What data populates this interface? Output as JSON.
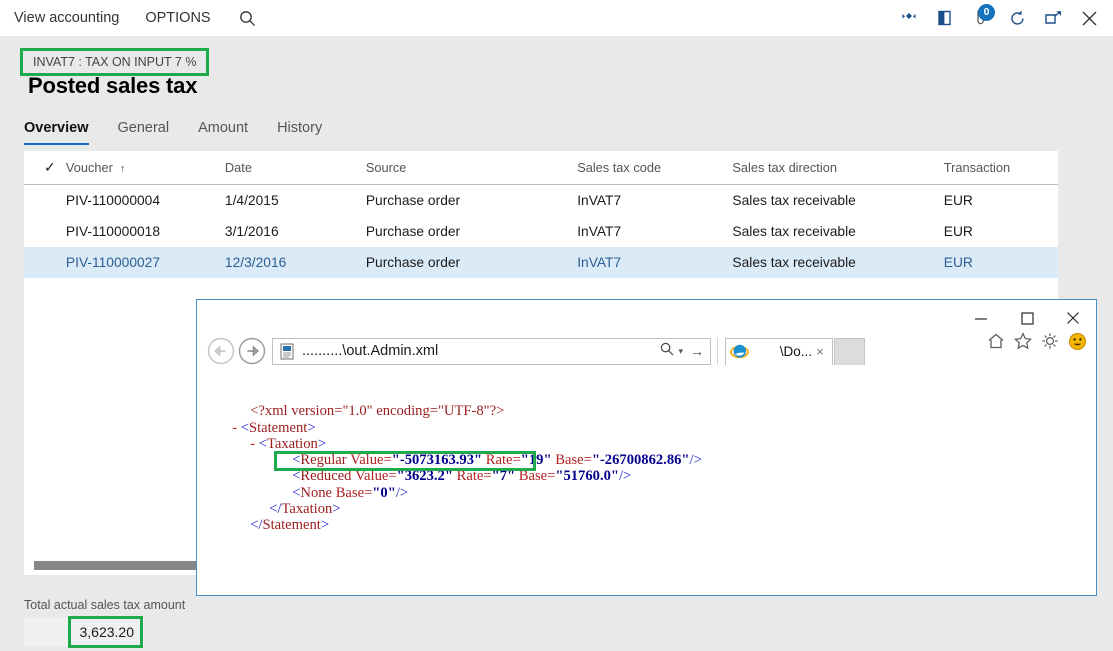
{
  "topbar": {
    "menu": [
      {
        "label": "View accounting",
        "name": "view-accounting-menu"
      },
      {
        "label": "OPTIONS",
        "name": "options-menu"
      }
    ],
    "search_icon": "search-icon",
    "right_icons": [
      {
        "name": "diamond-nav-icon",
        "glyph": "❖"
      },
      {
        "name": "company-icon",
        "glyph": "◧"
      },
      {
        "name": "notifications-icon",
        "glyph": "⚑",
        "badge": "0"
      },
      {
        "name": "refresh-icon",
        "glyph": "↻"
      },
      {
        "name": "popout-icon",
        "glyph": "↗"
      },
      {
        "name": "close-icon",
        "glyph": "✕"
      }
    ]
  },
  "header": {
    "breadcrumb": "INVAT7 : TAX ON INPUT 7 %",
    "title": "Posted sales tax"
  },
  "tabs": [
    {
      "label": "Overview",
      "active": true
    },
    {
      "label": "General",
      "active": false
    },
    {
      "label": "Amount",
      "active": false
    },
    {
      "label": "History",
      "active": false
    }
  ],
  "grid": {
    "columns": [
      "Voucher",
      "Date",
      "Source",
      "Sales tax code",
      "Sales tax direction",
      "Transaction"
    ],
    "sort_column": "Voucher",
    "sort_direction": "ascending",
    "check_glyph": "✓",
    "sort_glyph": "↑",
    "rows": [
      {
        "voucher": "PIV-110000004",
        "date": "1/4/2015",
        "source": "Purchase order",
        "code": "InVAT7",
        "direction": "Sales tax receivable",
        "currency": "EUR",
        "selected": false
      },
      {
        "voucher": "PIV-110000018",
        "date": "3/1/2016",
        "source": "Purchase order",
        "code": "InVAT7",
        "direction": "Sales tax receivable",
        "currency": "EUR",
        "selected": false
      },
      {
        "voucher": "PIV-110000027",
        "date": "12/3/2016",
        "source": "Purchase order",
        "code": "InVAT7",
        "direction": "Sales tax receivable",
        "currency": "EUR",
        "selected": true
      }
    ]
  },
  "total": {
    "label": "Total actual sales tax amount",
    "value": "3,623.20"
  },
  "browser": {
    "address": "..........\\out.Admin.xml",
    "tab_label": "\\Do...",
    "tab_close": "×",
    "nav": {
      "back": "←",
      "forward": "→",
      "search_dropdown": "▾",
      "go": "→"
    },
    "window_buttons": {
      "minimize": "─",
      "maximize": "□",
      "close": "✕"
    },
    "tools": [
      {
        "name": "home-icon",
        "glyph": "⌂"
      },
      {
        "name": "favorites-star-icon",
        "glyph": "☆"
      },
      {
        "name": "settings-gear-icon",
        "glyph": "⚙"
      },
      {
        "name": "smiley-feedback-icon",
        "glyph": "☺"
      }
    ]
  },
  "xml": {
    "declaration": "<?xml version=\"1.0\" encoding=\"UTF-8\"?>",
    "lines": [
      {
        "indent": 0,
        "minus": false,
        "text": "<?xml version=\"1.0\" encoding=\"UTF-8\"?>",
        "kind": "pi"
      },
      {
        "indent": 0,
        "minus": true,
        "text": "<Statement>",
        "kind": "tag"
      },
      {
        "indent": 1,
        "minus": true,
        "text": "<Taxation>",
        "kind": "tag"
      },
      {
        "indent": 3,
        "minus": false,
        "text": "<Regular Value=\"-5073163.93\" Rate=\"19\" Base=\"-26700862.86\"/>",
        "kind": "el"
      },
      {
        "indent": 3,
        "minus": false,
        "text": "<Reduced Value=\"3623.2\" Rate=\"7\" Base=\"51760.0\"/>",
        "kind": "el"
      },
      {
        "indent": 3,
        "minus": false,
        "text": "<None Base=\"0\"/>",
        "kind": "el"
      },
      {
        "indent": 1,
        "minus": false,
        "text": "</Taxation>",
        "kind": "tag"
      },
      {
        "indent": 0,
        "minus": false,
        "text": "</Statement>",
        "kind": "tag"
      }
    ],
    "elements": [
      {
        "name": "Regular",
        "value": "-5073163.93",
        "rate": "19",
        "base": "-26700862.86"
      },
      {
        "name": "Reduced",
        "value": "3623.2",
        "rate": "7",
        "base": "51760.0"
      },
      {
        "name": "None",
        "base": "0"
      }
    ]
  },
  "highlights": {
    "color": "#1faa4b",
    "boxes": [
      "breadcrumb",
      "reduced-xml-line",
      "total-value"
    ]
  }
}
